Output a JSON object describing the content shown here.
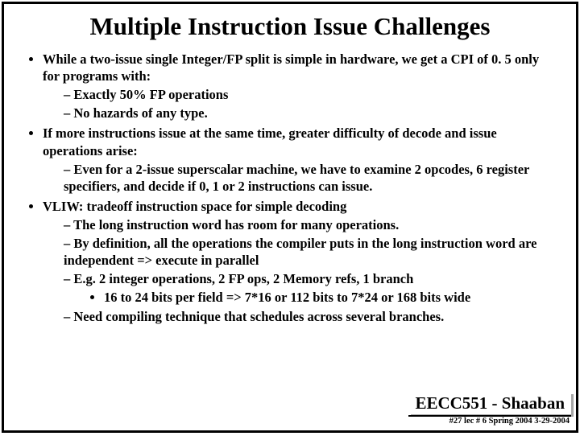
{
  "title": "Multiple Instruction Issue Challenges",
  "bullets": {
    "b1_1": "While a two-issue single Integer/FP split is simple in hardware, we get a CPI of  0. 5 only for programs with:",
    "b1_1_d1": "Exactly  50%  FP operations",
    "b1_1_d2": "No hazards of any type.",
    "b1_2": "If more instructions issue at the same time, greater difficulty of decode and issue operations arise:",
    "b1_2_d1": "Even for a  2-issue superscalar machine, we have to examine  2 opcodes, 6 register specifiers, and decide if  0, 1  or  2 instructions can issue.",
    "b1_3": "VLIW: tradeoff instruction space for simple decoding",
    "b1_3_d1": "The long instruction word has room for many operations.",
    "b1_3_d2": "By definition, all the operations the compiler puts in the long instruction word are independent  =>  execute in parallel",
    "b1_3_d3": "E.g.  2 integer operations,  2 FP ops,  2 Memory refs, 1 branch",
    "b1_3_d3_b1": "16 to 24 bits per field   =>  7*16 or 112 bits to 7*24 or 168 bits wide",
    "b1_3_d4": "Need compiling technique that schedules across several branches."
  },
  "footer": {
    "course": "EECC551 - Shaaban",
    "meta": "#27  lec # 6    Spring 2004  3-29-2004"
  }
}
